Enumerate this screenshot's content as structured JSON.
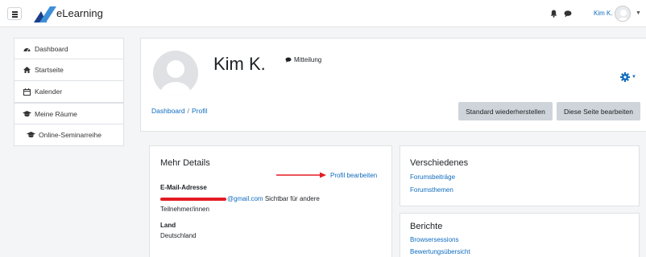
{
  "navbar": {
    "brand": "eLearning",
    "user_name": "Kim K."
  },
  "sidebar": {
    "items": [
      {
        "label": "Dashboard",
        "icon": "dashboard-icon"
      },
      {
        "label": "Startseite",
        "icon": "home-icon"
      },
      {
        "label": "Kalender",
        "icon": "calendar-icon"
      },
      {
        "label": "Meine Räume",
        "icon": "graduation-cap-icon"
      },
      {
        "label": "Online-Seminarreihe",
        "icon": "graduation-cap-icon"
      }
    ]
  },
  "header": {
    "name": "Kim K.",
    "message_label": "Mitteilung",
    "breadcrumb": [
      "Dashboard",
      "Profil"
    ],
    "reset_button": "Standard wiederherstellen",
    "edit_button": "Diese Seite bearbeiten"
  },
  "details": {
    "title": "Mehr Details",
    "edit_profile": "Profil bearbeiten",
    "email_label": "E-Mail-Adresse",
    "email_visible": "@gmail.com",
    "email_note": "Sichtbar für andere",
    "email_note2": "Teilnehmer/innen",
    "country_label": "Land",
    "country_value": "Deutschland"
  },
  "misc": {
    "title": "Verschiedenes",
    "links": [
      "Forumsbeiträge",
      "Forumsthemen"
    ]
  },
  "reports": {
    "title": "Berichte",
    "links": [
      "Browsersessions",
      "Bewertungsübersicht"
    ]
  },
  "colors": {
    "link": "#0f6cbf",
    "button": "#ced4da",
    "annotation_red": "#e31b23"
  }
}
